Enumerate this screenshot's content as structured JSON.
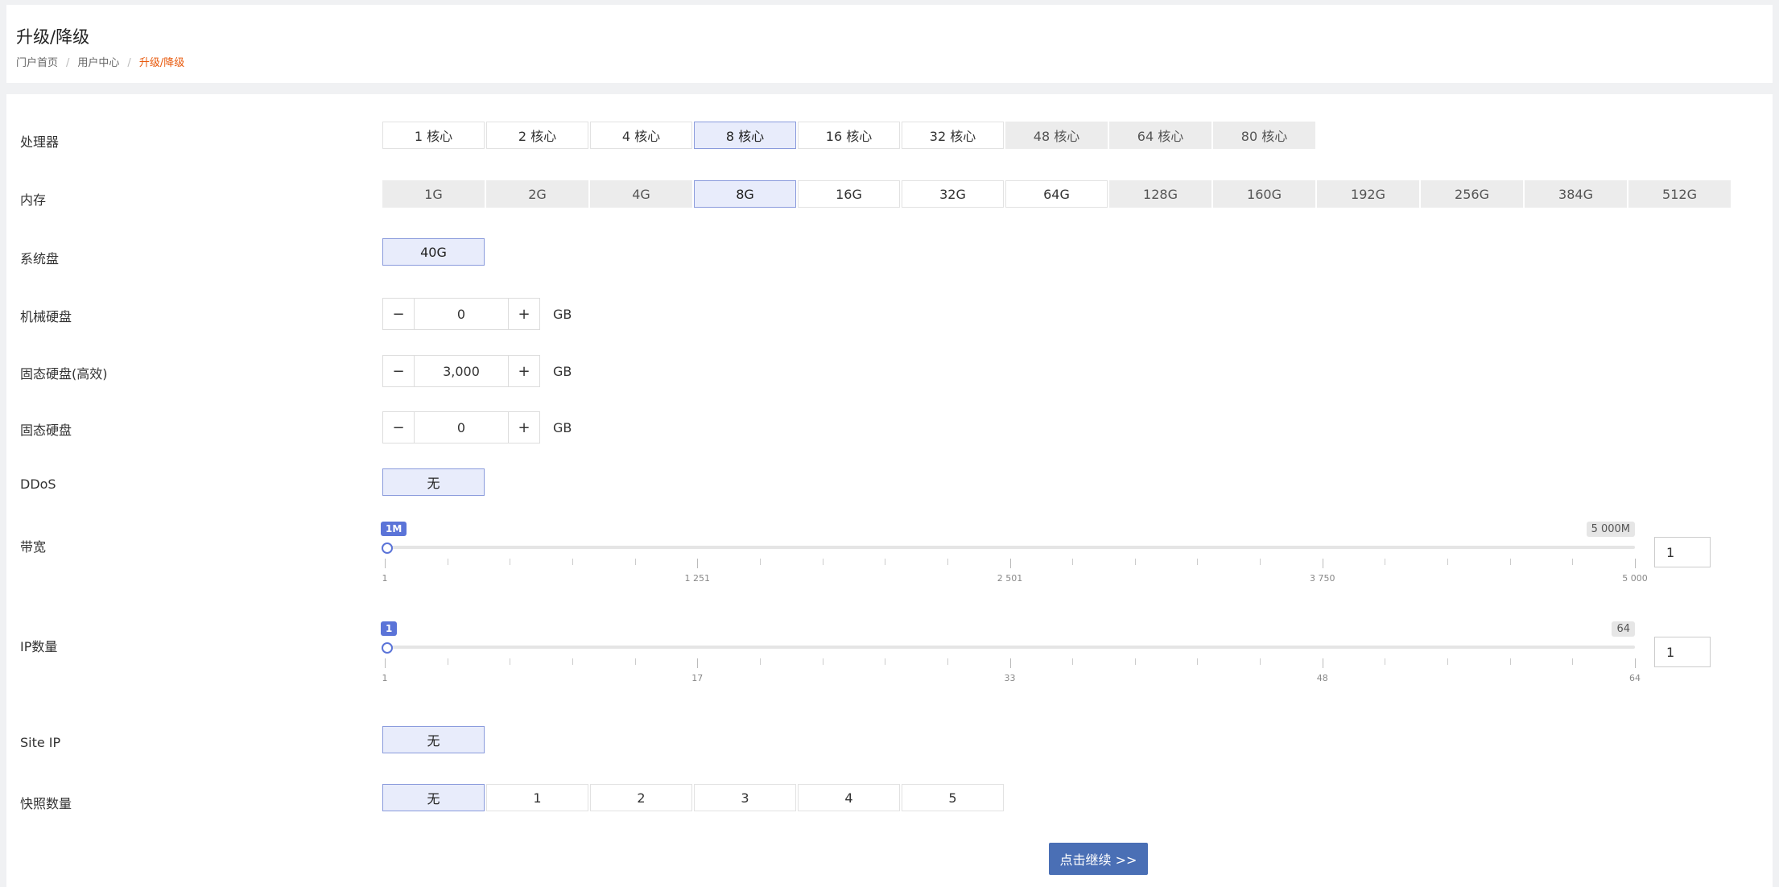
{
  "header": {
    "title": "升级/降级",
    "breadcrumb": [
      "门户首页",
      "用户中心",
      "升级/降级"
    ]
  },
  "cpu": {
    "label": "处理器",
    "options": [
      {
        "label": "1 核心",
        "state": "normal"
      },
      {
        "label": "2 核心",
        "state": "normal"
      },
      {
        "label": "4 核心",
        "state": "normal"
      },
      {
        "label": "8 核心",
        "state": "selected"
      },
      {
        "label": "16 核心",
        "state": "normal"
      },
      {
        "label": "32 核心",
        "state": "normal"
      },
      {
        "label": "48 核心",
        "state": "disabled"
      },
      {
        "label": "64 核心",
        "state": "disabled"
      },
      {
        "label": "80 核心",
        "state": "disabled"
      }
    ]
  },
  "memory": {
    "label": "内存",
    "options": [
      {
        "label": "1G",
        "state": "disabled"
      },
      {
        "label": "2G",
        "state": "disabled"
      },
      {
        "label": "4G",
        "state": "disabled"
      },
      {
        "label": "8G",
        "state": "selected"
      },
      {
        "label": "16G",
        "state": "normal"
      },
      {
        "label": "32G",
        "state": "normal"
      },
      {
        "label": "64G",
        "state": "normal"
      },
      {
        "label": "128G",
        "state": "disabled"
      },
      {
        "label": "160G",
        "state": "disabled"
      },
      {
        "label": "192G",
        "state": "disabled"
      },
      {
        "label": "256G",
        "state": "disabled"
      },
      {
        "label": "384G",
        "state": "disabled"
      },
      {
        "label": "512G",
        "state": "disabled"
      }
    ]
  },
  "system_disk": {
    "label": "系统盘",
    "options": [
      {
        "label": "40G",
        "state": "selected-disabled"
      }
    ]
  },
  "hdd": {
    "label": "机械硬盘",
    "value": "0",
    "unit": "GB",
    "minus": "−",
    "plus": "+"
  },
  "ssd_fast": {
    "label": "固态硬盘(高效)",
    "value": "3,000",
    "unit": "GB",
    "minus": "−",
    "plus": "+"
  },
  "ssd": {
    "label": "固态硬盘",
    "value": "0",
    "unit": "GB",
    "minus": "−",
    "plus": "+"
  },
  "ddos": {
    "label": "DDoS",
    "options": [
      {
        "label": "无",
        "state": "selected"
      }
    ]
  },
  "bandwidth": {
    "label": "带宽",
    "min_badge": "1M",
    "max_badge": "5 000M",
    "min": 1,
    "max": 5000,
    "value": 1,
    "input_value": "1",
    "tick_labels": [
      "1",
      "1 251",
      "2 501",
      "3 750",
      "5 000"
    ]
  },
  "ip_count": {
    "label": "IP数量",
    "min_badge": "1",
    "max_badge": "64",
    "min": 1,
    "max": 64,
    "value": 1,
    "input_value": "1",
    "tick_labels": [
      "1",
      "17",
      "33",
      "48",
      "64"
    ]
  },
  "site_ip": {
    "label": "Site IP",
    "options": [
      {
        "label": "无",
        "state": "selected"
      }
    ]
  },
  "snapshots": {
    "label": "快照数量",
    "options": [
      {
        "label": "无",
        "state": "selected"
      },
      {
        "label": "1",
        "state": "normal"
      },
      {
        "label": "2",
        "state": "normal"
      },
      {
        "label": "3",
        "state": "normal"
      },
      {
        "label": "4",
        "state": "normal"
      },
      {
        "label": "5",
        "state": "normal"
      }
    ]
  },
  "continue_button": "点击继续 >>",
  "colors": {
    "accent": "#5b74d8",
    "selected_bg": "#e8ecfb",
    "button": "#4a6fb5",
    "breadcrumb_current": "#e8590c"
  }
}
